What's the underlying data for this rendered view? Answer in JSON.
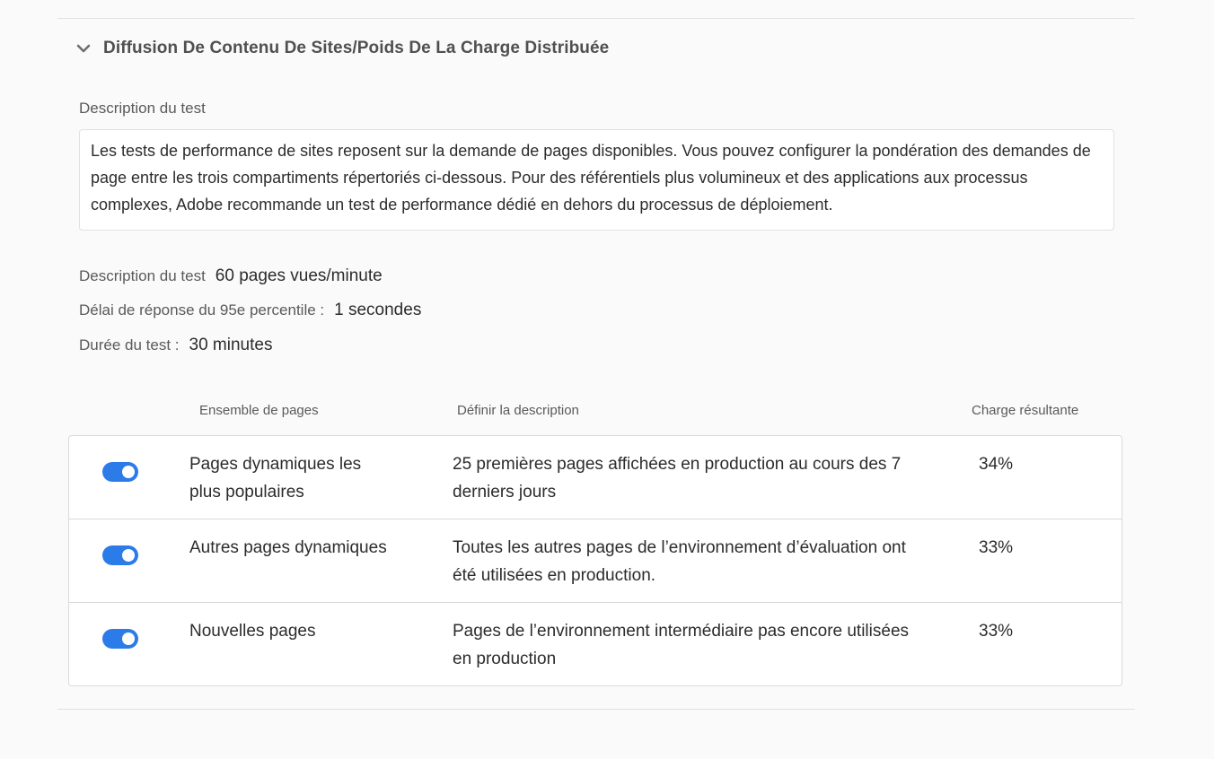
{
  "section": {
    "title": "Diffusion De Contenu De Sites/Poids De La Charge Distribuée"
  },
  "description": {
    "label": "Description du test",
    "text": "Les tests de performance de sites reposent sur la demande de pages disponibles. Vous pouvez configurer la pondération des demandes de page entre les trois compartiments répertoriés ci-dessous. Pour des référentiels plus volumineux et des applications aux processus complexes, Adobe recommande un test de performance dédié en dehors du processus de déploiement."
  },
  "info": [
    {
      "label": "Description du test",
      "value": "60 pages vues/minute"
    },
    {
      "label": "Délai de réponse du 95e percentile :",
      "value": "1 secondes"
    },
    {
      "label": "Durée du test :",
      "value": "30 minutes"
    }
  ],
  "table": {
    "headers": [
      "Ensemble de pages",
      "Définir la description",
      "Charge résultante"
    ],
    "rows": [
      {
        "enabled": true,
        "name": "Pages dynamiques les plus populaires",
        "description": "25 premières pages affichées en production au cours des 7 derniers jours",
        "load": "34%"
      },
      {
        "enabled": true,
        "name": "Autres pages dynamiques",
        "description": "Toutes les autres pages de l’environnement d’évaluation ont été utilisées en production.",
        "load": "33%"
      },
      {
        "enabled": true,
        "name": "Nouvelles pages",
        "description": "Pages de l’environnement intermédiaire pas encore utilisées en production",
        "load": "33%"
      }
    ]
  },
  "colors": {
    "accent": "#2b7ce8",
    "background": "#fafafa",
    "border": "#dadada"
  },
  "icons": {
    "collapse": "chevron-down-icon"
  }
}
